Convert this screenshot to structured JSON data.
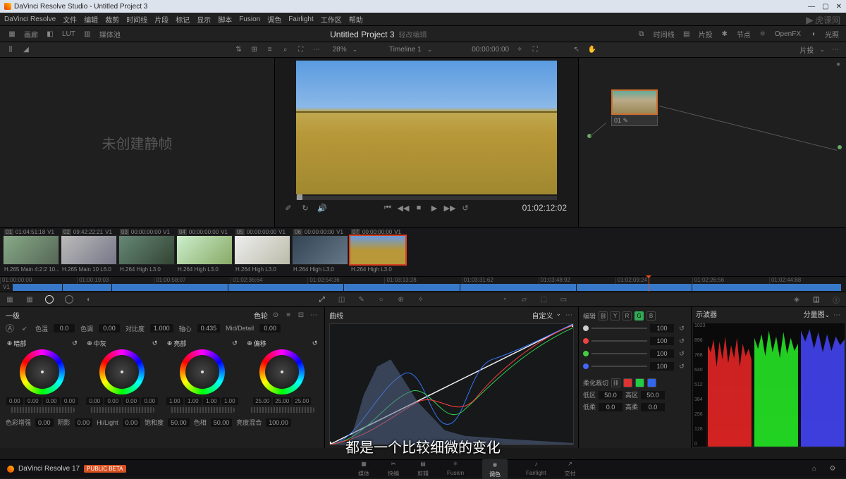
{
  "titlebar": {
    "app": "DaVinci Resolve Studio",
    "project": "Untitled Project 3"
  },
  "menu": [
    "DaVinci Resolve",
    "文件",
    "编辑",
    "裁剪",
    "时间线",
    "片段",
    "标记",
    "显示",
    "脚本",
    "Fusion",
    "调色",
    "Fairlight",
    "工作区",
    "帮助"
  ],
  "toolbar": {
    "left": [
      "画廊",
      "LUT",
      "媒体池"
    ],
    "title": "Untitled Project 3",
    "subtitle": "轻改编辑",
    "right": [
      "时间线",
      "片投",
      "节点",
      "OpenFX",
      "光照"
    ]
  },
  "subtoolbar": {
    "zoom": "28%",
    "timeline_name": "Timeline 1",
    "timecode": "00:00:00:00",
    "right_mode": "片投"
  },
  "gallery_placeholder": "未创建静帧",
  "viewer": {
    "tc": "01:02:12:02"
  },
  "node": {
    "label": "01"
  },
  "clips": [
    {
      "n": "01",
      "tc": "01:04:51:18",
      "trk": "V1",
      "codec": "H.265 Main 4:2:2 10...",
      "grad": "linear-gradient(135deg,#8a8,#565)"
    },
    {
      "n": "02",
      "tc": "09:42:22:21",
      "trk": "V1",
      "codec": "H.265 Main 10 L6.0",
      "grad": "linear-gradient(135deg,#bbb,#778)"
    },
    {
      "n": "03",
      "tc": "00:00:00:00",
      "trk": "V1",
      "codec": "H.264 High L3.0",
      "grad": "linear-gradient(135deg,#687,#343)"
    },
    {
      "n": "04",
      "tc": "00:00:00:00",
      "trk": "V1",
      "codec": "H.264 High L3.0",
      "grad": "linear-gradient(135deg,#cec,#8a6)"
    },
    {
      "n": "05",
      "tc": "00:00:00:00",
      "trk": "V1",
      "codec": "H.264 High L3.0",
      "grad": "linear-gradient(135deg,#eee,#bba)"
    },
    {
      "n": "06",
      "tc": "00:00:00:00",
      "trk": "V1",
      "codec": "H.264 High L3.0",
      "grad": "linear-gradient(135deg,#345,#678)"
    },
    {
      "n": "07",
      "tc": "00:00:00:00",
      "trk": "V1",
      "codec": "H.264 High L3.0",
      "grad": "linear-gradient(to bottom,#6a9be0 0%,#b89838 50%)"
    }
  ],
  "active_clip": 6,
  "timeline_ruler": [
    "01:00:00:00",
    "01:00:19:03",
    "01:00:58:07",
    "01:02:36:64",
    "01:02:54:36",
    "01:03:13:28",
    "01:03:31:62",
    "01:03:48:92",
    "01:02:09:24",
    "01:02:26:56",
    "01:02:44:88"
  ],
  "timeline_segments_pct": [
    6,
    6,
    14,
    14,
    14,
    14,
    14,
    18
  ],
  "primaries": {
    "title": "一级",
    "mode": "色轮",
    "params": [
      {
        "label": "色温",
        "val": "0.0"
      },
      {
        "label": "色调",
        "val": "0.00"
      },
      {
        "label": "对比度",
        "val": "1.000"
      },
      {
        "label": "轴心",
        "val": "0.435"
      },
      {
        "label": "Mid/Detail",
        "val": "0.00"
      }
    ],
    "wheels": [
      {
        "name": "暗部",
        "nums": [
          "0.00",
          "0.00",
          "0.00",
          "0.00"
        ]
      },
      {
        "name": "中灰",
        "nums": [
          "0.00",
          "0.00",
          "0.00",
          "0.00"
        ]
      },
      {
        "name": "亮部",
        "nums": [
          "1.00",
          "1.00",
          "1.00",
          "1.00"
        ]
      },
      {
        "name": "偏移",
        "nums": [
          "25.00",
          "25.00",
          "25.00"
        ]
      }
    ],
    "bottom": [
      {
        "label": "色彩增强",
        "val": "0.00"
      },
      {
        "label": "阴影",
        "val": "0.00"
      },
      {
        "label": "Hi/Light",
        "val": "0.00"
      },
      {
        "label": "饱和度",
        "val": "50.00"
      },
      {
        "label": "色相",
        "val": "50.00"
      },
      {
        "label": "亮度混合",
        "val": "100.00"
      }
    ]
  },
  "curves": {
    "title": "曲线",
    "mode": "自定义"
  },
  "edit_panel": {
    "title": "编辑",
    "channels": [
      "Y",
      "R",
      "G",
      "B"
    ],
    "intensity": [
      100,
      100,
      100,
      100
    ],
    "soft_clip": "柔化裁切",
    "low_label": "低区",
    "low_val": "50.0",
    "high_label": "高区",
    "high_val": "50.0",
    "ls_label": "低柔",
    "ls_val": "0.0",
    "hs_label": "高柔",
    "hs_val": "0.0"
  },
  "scopes": {
    "title": "示波器",
    "mode": "分量图",
    "scale": [
      "1023",
      "896",
      "768",
      "640",
      "512",
      "384",
      "256",
      "128",
      "0"
    ]
  },
  "footer": {
    "brand": "DaVinci Resolve 17",
    "beta": "PUBLIC BETA",
    "pages": [
      "媒体",
      "快编",
      "剪辑",
      "Fusion",
      "调色",
      "Fairlight",
      "交付"
    ],
    "active_page": 4
  },
  "subtitle": "都是一个比较细微的变化",
  "watermark": "虎课网"
}
